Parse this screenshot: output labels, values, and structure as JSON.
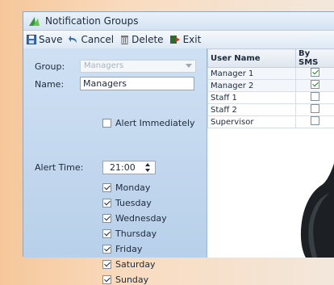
{
  "window": {
    "title": "Notification Groups"
  },
  "toolbar": {
    "save": "Save",
    "cancel": "Cancel",
    "delete": "Delete",
    "exit": "Exit"
  },
  "form": {
    "group_label": "Group:",
    "group_value": "Managers",
    "name_label": "Name:",
    "name_value": "Managers",
    "alert_immediately_label": "Alert Immediately",
    "alert_immediately_checked": false,
    "alert_time_label": "Alert Time:",
    "alert_time_value": "21:00",
    "days": [
      {
        "label": "Monday",
        "checked": true
      },
      {
        "label": "Tuesday",
        "checked": true
      },
      {
        "label": "Wednesday",
        "checked": true
      },
      {
        "label": "Thursday",
        "checked": true
      },
      {
        "label": "Friday",
        "checked": true
      },
      {
        "label": "Saturday",
        "checked": true
      },
      {
        "label": "Sunday",
        "checked": true
      }
    ]
  },
  "grid": {
    "headers": [
      "User Name",
      "By SMS"
    ],
    "rows": [
      {
        "name": "Manager 1",
        "sms": true
      },
      {
        "name": "Manager 2",
        "sms": true
      },
      {
        "name": "Staff 1",
        "sms": false
      },
      {
        "name": "Staff 2",
        "sms": false
      },
      {
        "name": "Supervisor",
        "sms": false
      }
    ]
  },
  "colors": {
    "panel": "#c6daf0",
    "accent_green": "#1f8a2a",
    "background": "#f6c79a"
  }
}
